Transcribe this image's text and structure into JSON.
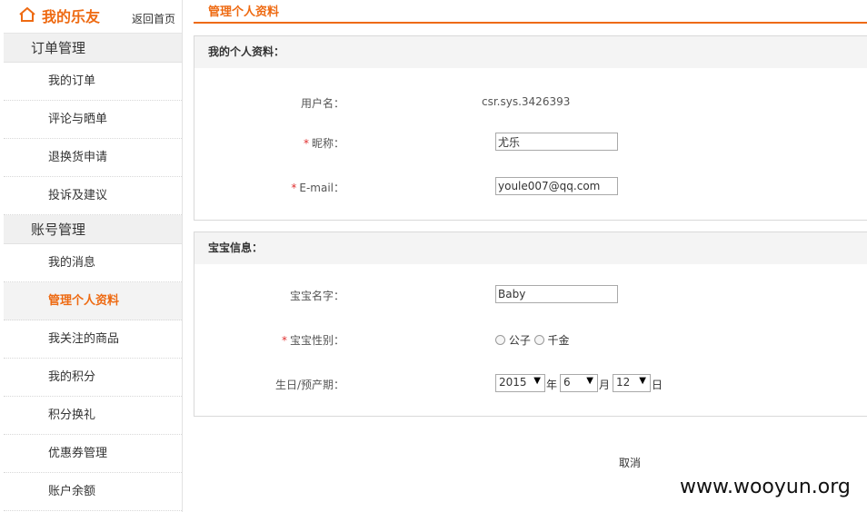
{
  "sidebar": {
    "title": "我的乐友",
    "back_link": "返回首页",
    "groups": [
      {
        "title": "订单管理",
        "items": [
          "我的订单",
          "评论与晒单",
          "退换货申请",
          "投诉及建议"
        ]
      },
      {
        "title": "账号管理",
        "items": [
          "我的消息",
          "管理个人资料",
          "我关注的商品",
          "我的积分",
          "积分换礼",
          "优惠券管理",
          "账户余额"
        ]
      }
    ],
    "active_item": "管理个人资料"
  },
  "main": {
    "title": "管理个人资料",
    "profile": {
      "header": "我的个人资料：",
      "username_label": "用户名：",
      "username_value": "csr.sys.3426393",
      "nickname_label": "昵称：",
      "nickname_value": "尤乐",
      "email_label": "E-mail：",
      "email_value": "youle007@qq.com",
      "required_mark": "*"
    },
    "baby": {
      "header": "宝宝信息：",
      "name_label": "宝宝名字：",
      "name_value": "Baby",
      "gender_label": "宝宝性别：",
      "gender_options": [
        "公子",
        "千金"
      ],
      "birthday_label": "生日/预产期：",
      "year": "2015",
      "year_unit": "年",
      "month": "6",
      "month_unit": "月",
      "day": "12",
      "day_unit": "日"
    },
    "cancel_label": "取消"
  },
  "watermark": "www.wooyun.org",
  "colors": {
    "accent": "#ee6a12",
    "required": "#e03030"
  }
}
